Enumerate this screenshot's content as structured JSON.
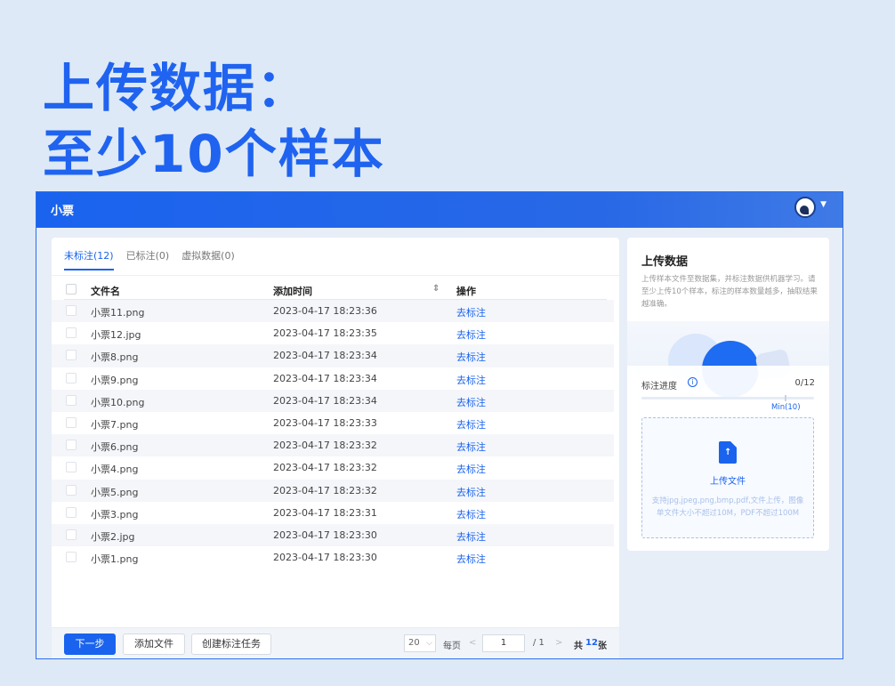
{
  "headline": {
    "line1": "上传数据：",
    "line2": "至少10个样本"
  },
  "app": {
    "title": "小票",
    "user_menu_caret": "▼"
  },
  "tabs": [
    {
      "label": "未标注(12)",
      "active": true
    },
    {
      "label": "已标注(0)",
      "active": false
    },
    {
      "label": "虚拟数据(0)",
      "active": false
    }
  ],
  "table": {
    "headers": {
      "name": "文件名",
      "time": "添加时间",
      "sort_icon": "⇕",
      "op": "操作"
    },
    "rows": [
      {
        "name": "小票11.png",
        "time": "2023-04-17 18:23:36",
        "op": "去标注"
      },
      {
        "name": "小票12.jpg",
        "time": "2023-04-17 18:23:35",
        "op": "去标注"
      },
      {
        "name": "小票8.png",
        "time": "2023-04-17 18:23:34",
        "op": "去标注"
      },
      {
        "name": "小票9.png",
        "time": "2023-04-17 18:23:34",
        "op": "去标注"
      },
      {
        "name": "小票10.png",
        "time": "2023-04-17 18:23:34",
        "op": "去标注"
      },
      {
        "name": "小票7.png",
        "time": "2023-04-17 18:23:33",
        "op": "去标注"
      },
      {
        "name": "小票6.png",
        "time": "2023-04-17 18:23:32",
        "op": "去标注"
      },
      {
        "name": "小票4.png",
        "time": "2023-04-17 18:23:32",
        "op": "去标注"
      },
      {
        "name": "小票5.png",
        "time": "2023-04-17 18:23:32",
        "op": "去标注"
      },
      {
        "name": "小票3.png",
        "time": "2023-04-17 18:23:31",
        "op": "去标注"
      },
      {
        "name": "小票2.jpg",
        "time": "2023-04-17 18:23:30",
        "op": "去标注"
      },
      {
        "name": "小票1.png",
        "time": "2023-04-17 18:23:30",
        "op": "去标注"
      }
    ]
  },
  "footer": {
    "next_label": "下一步",
    "add_label": "添加文件",
    "task_label": "创建标注任务",
    "page_size": "20",
    "page_size_chevron": "⌵",
    "per_page": "每页",
    "prev_arrow": "<",
    "current_page": "1",
    "total_pages": "/ 1",
    "next_arrow": ">",
    "total_prefix": "共",
    "total_count": "12",
    "total_suffix": "张"
  },
  "upload_panel": {
    "title": "上传数据",
    "description": "上传样本文件至数据集，并标注数据供机器学习。请至少上传10个样本，标注的样本数量越多，抽取结果越准确。",
    "progress_label": "标注进度",
    "info_icon": "i",
    "progress_count": "0/12",
    "progress_value": 0,
    "min_label": "Min(10)",
    "upload_label": "上传文件",
    "upload_hint": "支持jpg,jpeg,png,bmp,pdf,文件上传，图像单文件大小不超过10M，PDF不超过100M"
  },
  "colors": {
    "accent": "#1a63ee",
    "headline": "#1f63f0",
    "background": "#dde9f6"
  }
}
